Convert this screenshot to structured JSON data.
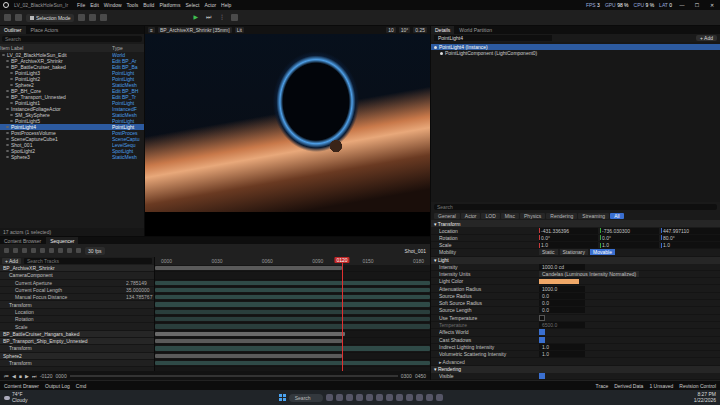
{
  "menubar": {
    "title": "LV_02_BlackHoleSun_Ir",
    "menus": [
      "File",
      "Edit",
      "Window",
      "Tools",
      "Build",
      "Platforms",
      "Select",
      "Actor",
      "Help"
    ],
    "stats": [
      {
        "label": "FPS",
        "value": "3"
      },
      {
        "label": "GPU",
        "value": "98 %"
      },
      {
        "label": "CPU",
        "value": "9 %"
      },
      {
        "label": "LAT",
        "value": "0"
      }
    ],
    "controls": [
      "—",
      "☐",
      "✕"
    ]
  },
  "toolbar": {
    "mode": "Selection Mode",
    "play": [
      "▶",
      "⏭",
      "⋮"
    ]
  },
  "outliner": {
    "tabs": [
      {
        "label": "Outliner",
        "selected": true
      },
      {
        "label": "Place Actors",
        "selected": false
      }
    ],
    "search": "Search",
    "columns": [
      "Item Label",
      "Type"
    ],
    "rows": [
      {
        "label": "LV_02_BlackHoleSun_Edit",
        "type": "World",
        "depth": 0,
        "selected": false
      },
      {
        "label": "BP_ArchiveXR_Shrinkr",
        "type": "Edit BP_Ar",
        "depth": 1,
        "selected": false
      },
      {
        "label": "BP_BattleCruiser_baked",
        "type": "Edit BP_Ba",
        "depth": 1,
        "selected": false
      },
      {
        "label": "PointLight3",
        "type": "PointLight",
        "depth": 2,
        "selected": false
      },
      {
        "label": "PointLight2",
        "type": "PointLight",
        "depth": 2,
        "selected": false
      },
      {
        "label": "Sphere2",
        "type": "StaticMesh",
        "depth": 2,
        "selected": false
      },
      {
        "label": "BP_BH_Core",
        "type": "Edit BP_BH",
        "depth": 1,
        "selected": false
      },
      {
        "label": "BP_Transport_Unnested",
        "type": "Edit BP_Tr",
        "depth": 1,
        "selected": false
      },
      {
        "label": "PointLight1",
        "type": "PointLight",
        "depth": 2,
        "selected": false
      },
      {
        "label": "InstancedFoliageActor",
        "type": "InstancedF",
        "depth": 1,
        "selected": false
      },
      {
        "label": "SM_SkySphere",
        "type": "StaticMesh",
        "depth": 2,
        "selected": false
      },
      {
        "label": "PointLight5",
        "type": "PointLight",
        "depth": 2,
        "selected": false
      },
      {
        "label": "PointLight4",
        "type": "PointLight",
        "depth": 1,
        "selected": true
      },
      {
        "label": "PostProcessVolume",
        "type": "PostProces",
        "depth": 1,
        "selected": false
      },
      {
        "label": "SceneCaptureCube1",
        "type": "SceneCaptu",
        "depth": 1,
        "selected": false
      },
      {
        "label": "Shot_001",
        "type": "LevelSequ",
        "depth": 1,
        "selected": false
      },
      {
        "label": "SpotLight2",
        "type": "SpotLight",
        "depth": 1,
        "selected": false
      },
      {
        "label": "Sphere3",
        "type": "StaticMesh",
        "depth": 1,
        "selected": false
      }
    ],
    "footer": "17 actors (1 selected)"
  },
  "viewport": {
    "camera": "BP_ArchiveXR_Shrinkr [35mm]",
    "mode": "Lit",
    "snaps": [
      "10",
      "10°",
      "0.25"
    ]
  },
  "bottomTabs": [
    {
      "label": "Content Browser",
      "selected": false
    },
    {
      "label": "Sequencer",
      "selected": true
    }
  ],
  "sequencer": {
    "fps": "30 fps",
    "shot": "Shot_001",
    "add": "+ Add",
    "search": "Search Tracks",
    "playhead": "0120",
    "playheadLevel": 0.68,
    "ticks": [
      "0000",
      "0030",
      "0060",
      "0090",
      "0150",
      "0180"
    ],
    "tracks": [
      {
        "label": "BP_ArchiveXR_Shrinkr",
        "value": "",
        "depth": 0,
        "kind": "actor",
        "span": [
          0,
          0.68
        ],
        "color": "#5a5a5a"
      },
      {
        "label": "CameraComponent",
        "value": "",
        "depth": 1,
        "kind": "group",
        "span": [
          0,
          0
        ],
        "color": "#2a2a2a"
      },
      {
        "label": "Current Aperture",
        "value": "2.785149",
        "depth": 2,
        "kind": "property",
        "span": [
          0,
          1
        ],
        "color": "#2f4a47"
      },
      {
        "label": "Current Focal Length",
        "value": "35.000000",
        "depth": 2,
        "kind": "property",
        "span": [
          0,
          1
        ],
        "color": "#2f4a47"
      },
      {
        "label": "Manual Focus Distance",
        "value": "134.785767",
        "depth": 2,
        "kind": "property",
        "span": [
          0,
          1
        ],
        "color": "#2f4a47"
      },
      {
        "label": "Transform",
        "value": "",
        "depth": 1,
        "kind": "group",
        "span": [
          0,
          1
        ],
        "color": "#2f4a47"
      },
      {
        "label": "Location",
        "value": "",
        "depth": 2,
        "kind": "property",
        "span": [
          0,
          1
        ],
        "color": "#2a3e3c"
      },
      {
        "label": "Rotation",
        "value": "",
        "depth": 2,
        "kind": "property",
        "span": [
          0,
          1
        ],
        "color": "#2a3e3c"
      },
      {
        "label": "Scale",
        "value": "",
        "depth": 2,
        "kind": "property",
        "span": [
          0,
          1
        ],
        "color": "#2a3e3c"
      },
      {
        "label": "BP_BattleCruiser_Hangars_baked",
        "value": "",
        "depth": 0,
        "kind": "actor",
        "span": [
          0,
          0.69
        ],
        "color": "#6a6a6a"
      },
      {
        "label": "BP_Transport_Ship_Empty_Unnested",
        "value": "",
        "depth": 0,
        "kind": "actor",
        "span": [
          0,
          0.68
        ],
        "color": "#5a5a5a"
      },
      {
        "label": "Transform",
        "value": "",
        "depth": 1,
        "kind": "group",
        "span": [
          0,
          1
        ],
        "color": "#2f4a47"
      },
      {
        "label": "Sphere2",
        "value": "",
        "depth": 0,
        "kind": "actor",
        "span": [
          0,
          0.68
        ],
        "color": "#5a5a5a"
      },
      {
        "label": "Transform",
        "value": "",
        "depth": 1,
        "kind": "group",
        "span": [
          0,
          1
        ],
        "color": "#2f4a47"
      }
    ],
    "transport": [
      "⏮",
      "◀",
      "■",
      "▶",
      "⏭"
    ],
    "range": [
      "-0120",
      "0000",
      "0300",
      "0450"
    ]
  },
  "details": {
    "tabs": [
      {
        "label": "Details",
        "selected": true
      },
      {
        "label": "World Partition",
        "selected": false
      }
    ],
    "name": "PointLight4",
    "add": "+ Add",
    "tree": [
      {
        "label": "PointLight4 (Instance)",
        "depth": 0,
        "selected": true
      },
      {
        "label": "PointLightComponent (LightComponent0)",
        "depth": 1,
        "selected": false
      }
    ],
    "search": "Search",
    "filters": [
      {
        "label": "General",
        "selected": false
      },
      {
        "label": "Actor",
        "selected": false
      },
      {
        "label": "LOD",
        "selected": false
      },
      {
        "label": "Misc",
        "selected": false
      },
      {
        "label": "Physics",
        "selected": false
      },
      {
        "label": "Rendering",
        "selected": false
      },
      {
        "label": "Streaming",
        "selected": false
      },
      {
        "label": "All",
        "selected": true
      }
    ],
    "sections": [
      {
        "title": "Transform",
        "rows": [
          {
            "kind": "vector",
            "label": "Location",
            "values": [
              "-431.336396",
              "-736.030300",
              "447.997110"
            ],
            "disabled": false
          },
          {
            "kind": "vector",
            "label": "Rotation",
            "values": [
              "0.0°",
              "0.0°",
              "80.0°"
            ],
            "disabled": false
          },
          {
            "kind": "vector",
            "label": "Scale",
            "values": [
              "1.0",
              "1.0",
              "1.0"
            ],
            "disabled": false
          },
          {
            "kind": "segmented",
            "label": "Mobility",
            "options": [
              {
                "label": "Static",
                "selected": false
              },
              {
                "label": "Stationary",
                "selected": false
              },
              {
                "label": "Movable",
                "selected": true
              }
            ],
            "disabled": false
          }
        ]
      },
      {
        "title": "Light",
        "rows": [
          {
            "kind": "number",
            "label": "Intensity",
            "value": "1000.0 cd",
            "disabled": false
          },
          {
            "kind": "dropdown",
            "label": "Intensity Units",
            "value": "Candelas (Luminous Intensity Normalized)",
            "disabled": false
          },
          {
            "kind": "color",
            "label": "Light Color",
            "color": "#f0a868",
            "disabled": false
          },
          {
            "kind": "number",
            "label": "Attenuation Radius",
            "value": "1000.0",
            "disabled": false
          },
          {
            "kind": "number",
            "label": "Source Radius",
            "value": "0.0",
            "disabled": false
          },
          {
            "kind": "number",
            "label": "Soft Source Radius",
            "value": "0.0",
            "disabled": false
          },
          {
            "kind": "number",
            "label": "Source Length",
            "value": "0.0",
            "disabled": false
          },
          {
            "kind": "checkbox",
            "label": "Use Temperature",
            "checked": false,
            "disabled": false
          },
          {
            "kind": "number",
            "label": "Temperature",
            "value": "6500.0",
            "disabled": true
          },
          {
            "kind": "checkbox",
            "label": "Affects World",
            "checked": true,
            "disabled": false
          },
          {
            "kind": "checkbox",
            "label": "Cast Shadows",
            "checked": true,
            "disabled": false
          },
          {
            "kind": "number",
            "label": "Indirect Lighting Intensity",
            "value": "1.0",
            "disabled": false
          },
          {
            "kind": "number",
            "label": "Volumetric Scattering Intensity",
            "value": "1.0",
            "disabled": false
          },
          {
            "kind": "header",
            "label": "Advanced",
            "disabled": false
          }
        ]
      },
      {
        "title": "Rendering",
        "rows": [
          {
            "kind": "checkbox",
            "label": "Visible",
            "checked": true,
            "disabled": false
          }
        ]
      }
    ]
  },
  "statusbar": {
    "left": [
      "Content Drawer",
      "Output Log",
      "Cmd"
    ],
    "right": [
      "Trace",
      "Derived Data",
      "1 Unsaved",
      "Revision Control"
    ]
  },
  "taskbar": {
    "temp": "74°F",
    "weather": "Cloudy",
    "search": "Search",
    "time": "8:27 PM",
    "date": "1/22/2026"
  }
}
